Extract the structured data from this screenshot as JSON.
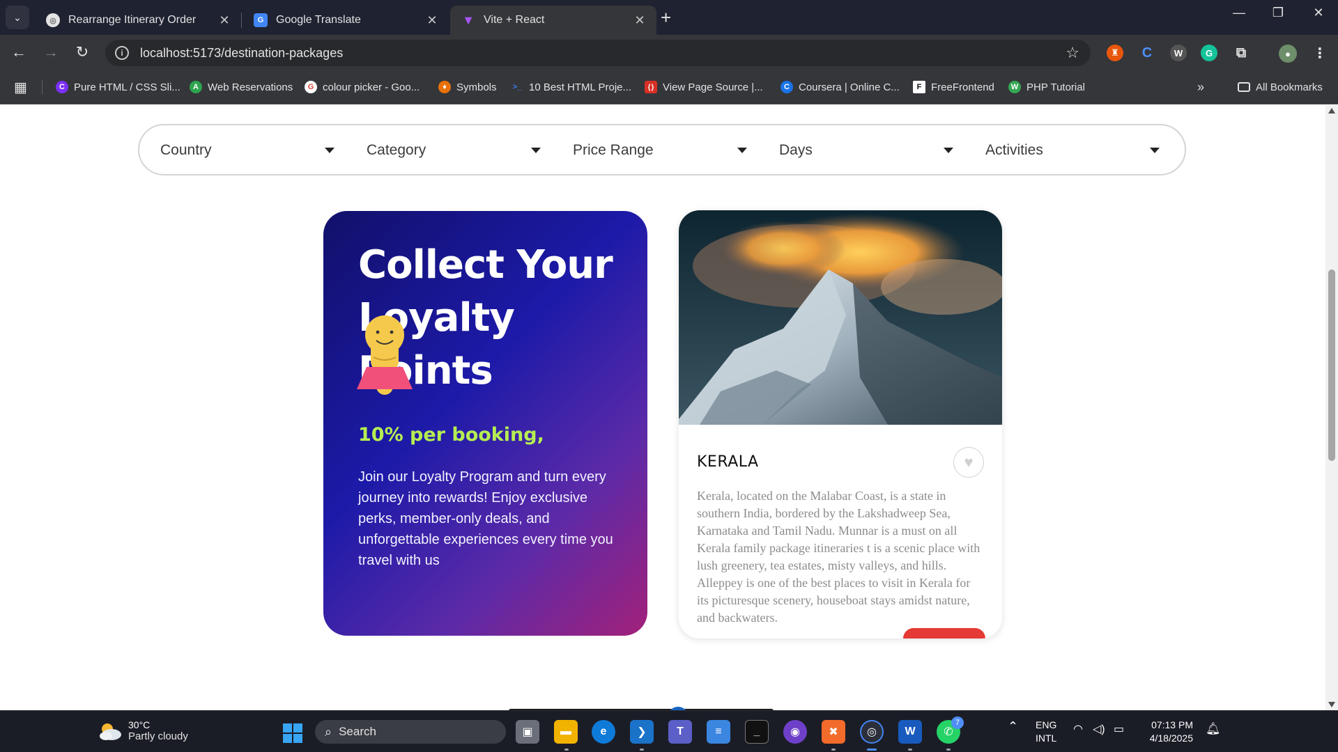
{
  "browser": {
    "tabs": [
      {
        "label": "Rearrange Itinerary Order",
        "active": false
      },
      {
        "label": "Google Translate",
        "active": false
      },
      {
        "label": "Vite + React",
        "active": true
      }
    ],
    "url": "localhost:5173/destination-packages",
    "bookmarks": [
      {
        "label": "Pure HTML / CSS Sli...",
        "icon": "c-logo-icon",
        "color": "#7b2ff7"
      },
      {
        "label": "Web Reservations",
        "icon": "a-logo-icon",
        "color": "#2ea44f"
      },
      {
        "label": "colour picker - Goo...",
        "icon": "google-icon",
        "color": "#ffffff"
      },
      {
        "label": "Symbols",
        "icon": "fire-icon",
        "color": "#e8710a"
      },
      {
        "label": "10 Best HTML Proje...",
        "icon": "terminal-icon",
        "color": "#3d7ef5"
      },
      {
        "label": "View Page Source |...",
        "icon": "code-icon",
        "color": "#d93025"
      },
      {
        "label": "Coursera | Online C...",
        "icon": "coursera-icon",
        "color": "#1a73e8"
      },
      {
        "label": "FreeFrontend",
        "icon": "f-logo-icon",
        "color": "#ffffff"
      },
      {
        "label": "PHP Tutorial",
        "icon": "w3-icon",
        "color": "#34a853"
      }
    ],
    "all_bookmarks": "All Bookmarks"
  },
  "filters": [
    {
      "label": "Country"
    },
    {
      "label": "Category"
    },
    {
      "label": "Price Range"
    },
    {
      "label": "Days"
    },
    {
      "label": "Activities"
    }
  ],
  "loyalty": {
    "headline_line1": "Collect Your",
    "headline_line2": "Loyalty",
    "headline_line3": "Points",
    "highlight": "10% per booking,",
    "description": "Join our Loyalty Program and turn every journey into rewards! Enjoy exclusive perks, member-only deals, and unforgettable experiences every time you travel with us"
  },
  "destination": {
    "title": "KERALA",
    "description": "Kerala, located on the Malabar Coast, is a state in southern India, bordered by the Lakshadweep Sea, Karnataka and Tamil Nadu. Munnar is a must on all Kerala family package itineraries t is a scenic place with lush greenery, tea estates, misty valleys, and hills. Alleppey is one of the best places to visit in Kerala for its picturesque scenery, houseboat stays amidst nature, and backwaters."
  },
  "taskbar": {
    "temperature": "30°C",
    "weather": "Partly cloudy",
    "search_label": "Search",
    "lang_line1": "ENG",
    "lang_line2": "INTL",
    "time": "07:13 PM",
    "date": "4/18/2025",
    "whatsapp_badge": "7"
  },
  "colors": {
    "accent_green": "#b6ee52",
    "book_red": "#e53935"
  }
}
